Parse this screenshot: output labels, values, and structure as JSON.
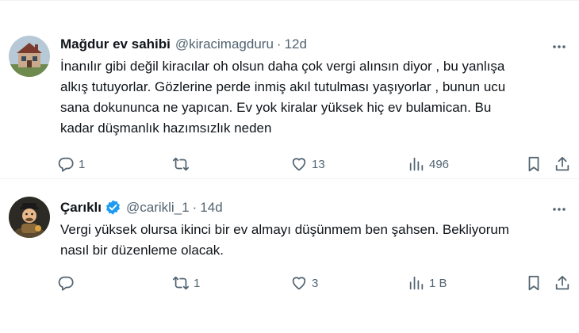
{
  "tweets": [
    {
      "name": "Mağdur ev sahibi",
      "handle": "@kiracimagduru",
      "separator": "·",
      "time": "12d",
      "text": "İnanılır gibi değil kiracılar oh olsun daha çok vergi alınsın diyor , bu yanlışa\nalkış tutuyorlar. Gözlerine perde inmiş akıl tutulması yaşıyorlar , bunun ucu\nsana dokununca ne yapıcan. Ev yok kiralar yüksek hiç ev bulamican. Bu\nkadar düşmanlık hazımsızlık neden",
      "replies": "1",
      "reposts": "",
      "likes": "13",
      "views": "496"
    },
    {
      "name": "Çarıklı",
      "handle": "@carikli_1",
      "separator": "·",
      "time": "14d",
      "text": "Vergi yüksek olursa ikinci bir ev almayı düşünmem ben şahsen. Bekliyorum\nnasıl bir düzenleme olacak.",
      "replies": "",
      "reposts": "1",
      "likes": "3",
      "views": "1 B"
    }
  ],
  "colors": {
    "text": "#0f1419",
    "secondary": "#536471",
    "verified": "#1d9bf0",
    "divider": "#eff3f4"
  },
  "icons": [
    "reply-icon",
    "repost-icon",
    "like-icon",
    "views-icon",
    "bookmark-icon",
    "share-icon",
    "more-icon",
    "verified-badge-icon"
  ]
}
